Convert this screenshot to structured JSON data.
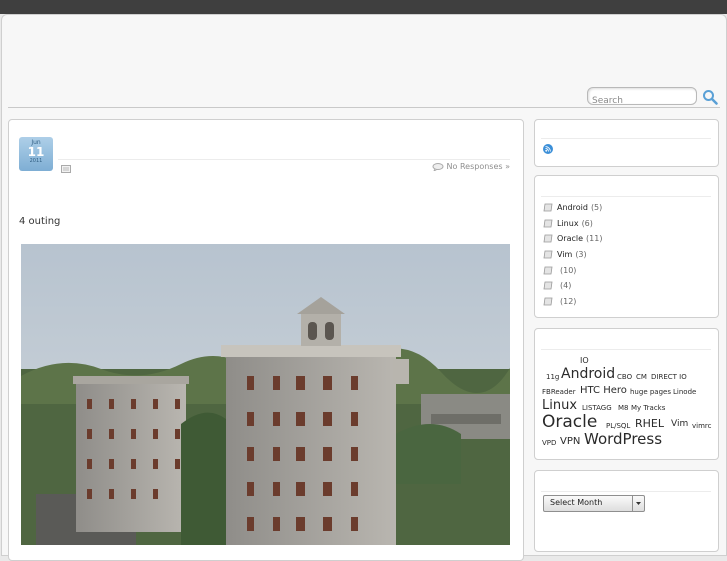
{
  "search": {
    "placeholder": "Search"
  },
  "post": {
    "date": {
      "month": "Jun",
      "day": "11",
      "year": "2011"
    },
    "responses": "No Responses »",
    "text": "4  outing"
  },
  "sidebar": {
    "categories": [
      {
        "name": "Android",
        "count": "(5)"
      },
      {
        "name": "Linux",
        "count": "(6)"
      },
      {
        "name": "Oracle",
        "count": "(11)"
      },
      {
        "name": "Vim",
        "count": "(3)"
      },
      {
        "name": "",
        "count": "(10)"
      },
      {
        "name": "",
        "count": "(4)"
      },
      {
        "name": "",
        "count": "(12)"
      }
    ],
    "tags": [
      "IO",
      "11g",
      "Android",
      "CBO",
      "CM",
      "DIRECT IO",
      "FBReader",
      "HTC Hero",
      "huge pages",
      "Linode",
      "Linux",
      "LISTAGG",
      "M8",
      "My Tracks",
      "Oracle",
      "PL/SQL",
      "RHEL",
      "Vim",
      "vimrc",
      "VPD",
      "VPN",
      "WordPress"
    ],
    "archive_select": "Select Month"
  },
  "colors": {
    "topbar": "#3f3f3f",
    "date_badge": "#8db9dc",
    "search_icon": "#5aa0d6",
    "rss": "#3b8fd8"
  }
}
